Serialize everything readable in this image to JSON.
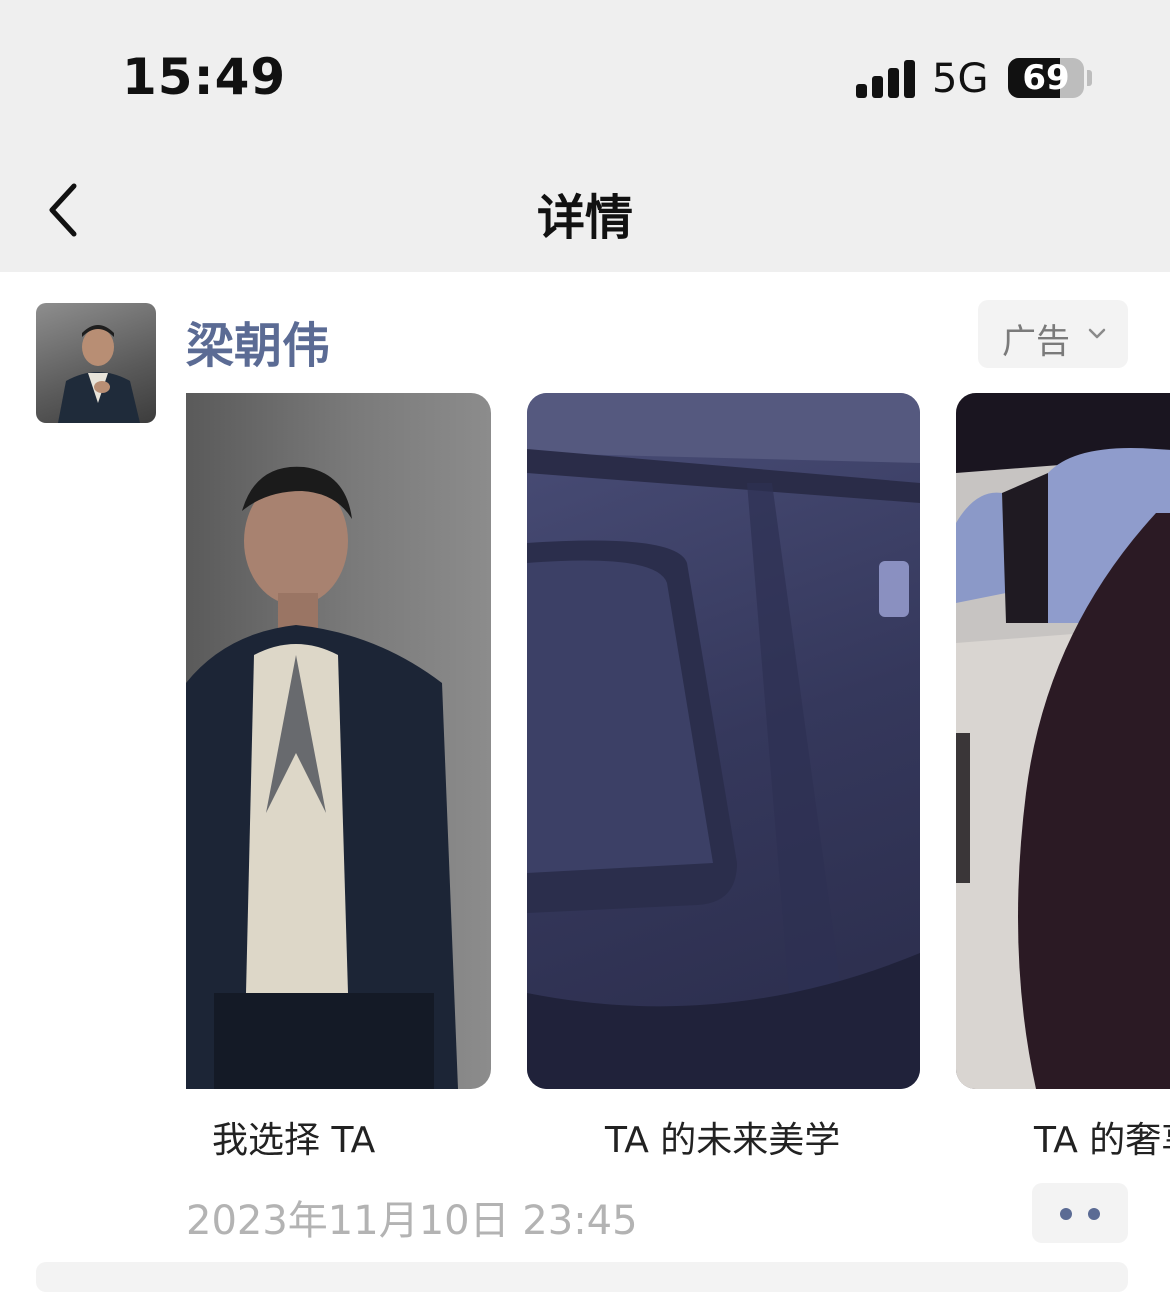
{
  "status": {
    "time": "15:49",
    "network": "5G",
    "battery": "69",
    "battery_level": 0.69
  },
  "nav": {
    "title": "详情",
    "back_icon": "chevron-left-icon"
  },
  "post": {
    "username": "梁朝伟",
    "ad_label": "广告",
    "ad_icon": "chevron-down-icon",
    "cards": [
      {
        "caption": "我选择 TA"
      },
      {
        "caption": "TA 的未来美学"
      },
      {
        "caption": "TA 的奢享"
      }
    ],
    "timestamp": "2023年11月10日 23:45",
    "more_icon": "more-dots-icon"
  },
  "colors": {
    "link": "#5b6b94",
    "bar_bg": "#efefef",
    "muted": "#b3b3b3"
  }
}
